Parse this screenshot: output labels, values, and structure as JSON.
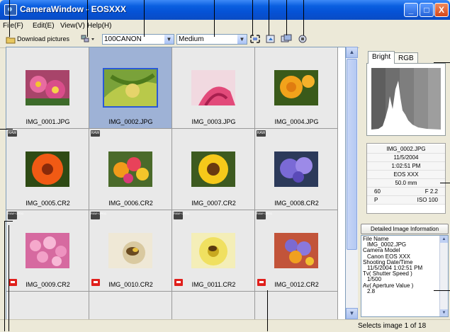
{
  "window": {
    "title": "CameraWindow - EOSXXX"
  },
  "titlebar_buttons": {
    "minimize": "_",
    "maximize": "□",
    "close": "X"
  },
  "menu": {
    "file": "File(F)",
    "edit": "Edit(E)",
    "view": "View(V)",
    "help": "Help(H)"
  },
  "toolbar": {
    "download_label": "Download pictures",
    "folder_select": "100CANON",
    "size_select": "Medium"
  },
  "grid": {
    "cells": [
      {
        "name": "IMG_0001.JPG",
        "badge": "",
        "protected": false,
        "selected": false
      },
      {
        "name": "IMG_0002.JPG",
        "badge": "",
        "protected": false,
        "selected": true
      },
      {
        "name": "IMG_0003.JPG",
        "badge": "",
        "protected": false,
        "selected": false
      },
      {
        "name": "IMG_0004.JPG",
        "badge": "",
        "protected": false,
        "selected": false
      },
      {
        "name": "IMG_0005.CR2",
        "badge": "RAW",
        "protected": false,
        "selected": false
      },
      {
        "name": "IMG_0006.CR2",
        "badge": "RAW",
        "protected": false,
        "selected": false
      },
      {
        "name": "IMG_0007.CR2",
        "badge": "RAW",
        "protected": false,
        "selected": false
      },
      {
        "name": "IMG_0008.CR2",
        "badge": "RAW",
        "protected": false,
        "selected": false
      },
      {
        "name": "IMG_0009.CR2",
        "badge": "RAW+JPEG",
        "protected": true,
        "selected": false
      },
      {
        "name": "IMG_0010.CR2",
        "badge": "RAW+JPEG",
        "protected": true,
        "selected": false
      },
      {
        "name": "IMG_0011.CR2",
        "badge": "RAW+JPEG",
        "protected": true,
        "selected": false
      },
      {
        "name": "IMG_0012.CR2",
        "badge": "RAW+JPEG",
        "protected": true,
        "selected": false
      }
    ]
  },
  "panel": {
    "tabs": [
      "Bright",
      "RGB"
    ],
    "info": {
      "filename": "IMG_0002.JPG",
      "date": "11/5/2004",
      "time": "1:02:51 PM",
      "camera": "EOS XXX",
      "focal": "50.0 mm",
      "shutter": "60",
      "aperture": "F 2.2",
      "mode": "P",
      "iso": "ISO 100"
    },
    "detail_button": "Detailed Image Information",
    "detail_lines": [
      {
        "text": "File Name",
        "indent": false
      },
      {
        "text": "IMG_0002.JPG",
        "indent": true
      },
      {
        "text": "Camera Model",
        "indent": false
      },
      {
        "text": "Canon EOS XXX",
        "indent": true
      },
      {
        "text": "Shooting Date/Time",
        "indent": false
      },
      {
        "text": "11/5/2004 1:02:51 PM",
        "indent": true
      },
      {
        "text": "Tv( Shutter Speed )",
        "indent": false
      },
      {
        "text": "1/500",
        "indent": true
      },
      {
        "text": "Av( Aperture Value )",
        "indent": false
      },
      {
        "text": "2.8",
        "indent": true
      }
    ]
  },
  "status": {
    "text": "Selects image 1 of 18"
  }
}
